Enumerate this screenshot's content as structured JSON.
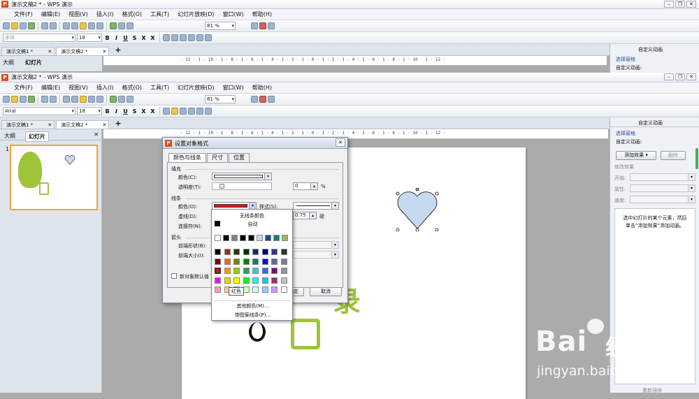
{
  "window_title_back": "演示文稿2 * - WPS 演示",
  "window_title_front": "演示文稿2 * - WPS 演示",
  "menu": [
    "文件(F)",
    "编辑(E)",
    "视图(V)",
    "插入(I)",
    "格式(O)",
    "工具(T)",
    "幻灯片放映(D)",
    "窗口(W)",
    "帮助(H)"
  ],
  "toolbar": {
    "zoom": "81 %",
    "font_back": "宋体",
    "font_front": "Arial",
    "size": "18"
  },
  "doc_tabs": [
    "演示文稿1 *",
    "演示文稿2 *"
  ],
  "left_tabs": [
    "大纲",
    "幻灯片"
  ],
  "slide_number": "1",
  "ruler_text": "· 12 · 1 · 10 · 1 · 8 · 1 · 6 · 1 · 4 · 1 · 2 · 1 · 0 · 1 · 2 · 1 · 4 · 1 · 6 · 1 · 8 · 1 · 10 · 1 · 12 ·",
  "right_panel": {
    "title": "自定义动画",
    "select_pane": "选择窗格",
    "section": "自定义动画:",
    "add_effect": "添加效果",
    "delete": "删除",
    "modify": "修改效果",
    "start": "开始:",
    "property": "属性:",
    "speed": "速度:",
    "hint": "选中幻灯片的某个元素，然后单击“添加效果”添加动画。",
    "rerank": "重新排序"
  },
  "dialog": {
    "title": "设置对象格式",
    "tabs": [
      "颜色与线条",
      "尺寸",
      "位置"
    ],
    "fill": "填充",
    "fill_color": "颜色(C):",
    "transparency": "透明度(T):",
    "trans_value": "0",
    "percent": "%",
    "line": "线条",
    "line_color": "颜色(O):",
    "style": "样式(S):",
    "dash": "虚线(D):",
    "weight_value": "0.75",
    "weight_unit": "磅",
    "connector": "连接符(N):",
    "arrows": "箭头",
    "begin_style": "前端形状(B):",
    "begin_size": "前端大小(I):",
    "default_check": "新对象默认值",
    "ok": "确定",
    "cancel": "取消"
  },
  "palette": {
    "no_line": "无线条颜色",
    "auto": "自动",
    "tooltip": "红色",
    "more": "其他颜色(M)...",
    "patterned": "带图案线条(P)...",
    "recent": [
      "#ffffff",
      "#000000",
      "#808080",
      "#000000",
      "#000000",
      "#c6d9f0",
      "#1f497d",
      "#1f7b7b",
      "#9bbb59"
    ],
    "grid": [
      [
        "#000000",
        "#993300",
        "#333300",
        "#003300",
        "#003366",
        "#000080",
        "#333399",
        "#333333"
      ],
      [
        "#800000",
        "#ff6600",
        "#808000",
        "#008000",
        "#008080",
        "#0000ff",
        "#666699",
        "#808080"
      ],
      [
        "#ff0000",
        "#ff9900",
        "#99cc00",
        "#339966",
        "#33cccc",
        "#3366ff",
        "#800080",
        "#969696"
      ],
      [
        "#ff00ff",
        "#ffcc00",
        "#ffff00",
        "#00ff00",
        "#00ffff",
        "#00ccff",
        "#993366",
        "#c0c0c0"
      ],
      [
        "#ff99cc",
        "#ffcc99",
        "#ffff99",
        "#ccffcc",
        "#ccffff",
        "#99ccff",
        "#cc99ff",
        "#ffffff"
      ]
    ]
  },
  "watermark": {
    "brand": "Bai",
    "brand2": "经验",
    "url": "jingyan.baidu.com"
  },
  "colors": {
    "heart": "#c6d9f0",
    "selected_line": "#e0161c",
    "logo_green": "#9ec43a"
  }
}
